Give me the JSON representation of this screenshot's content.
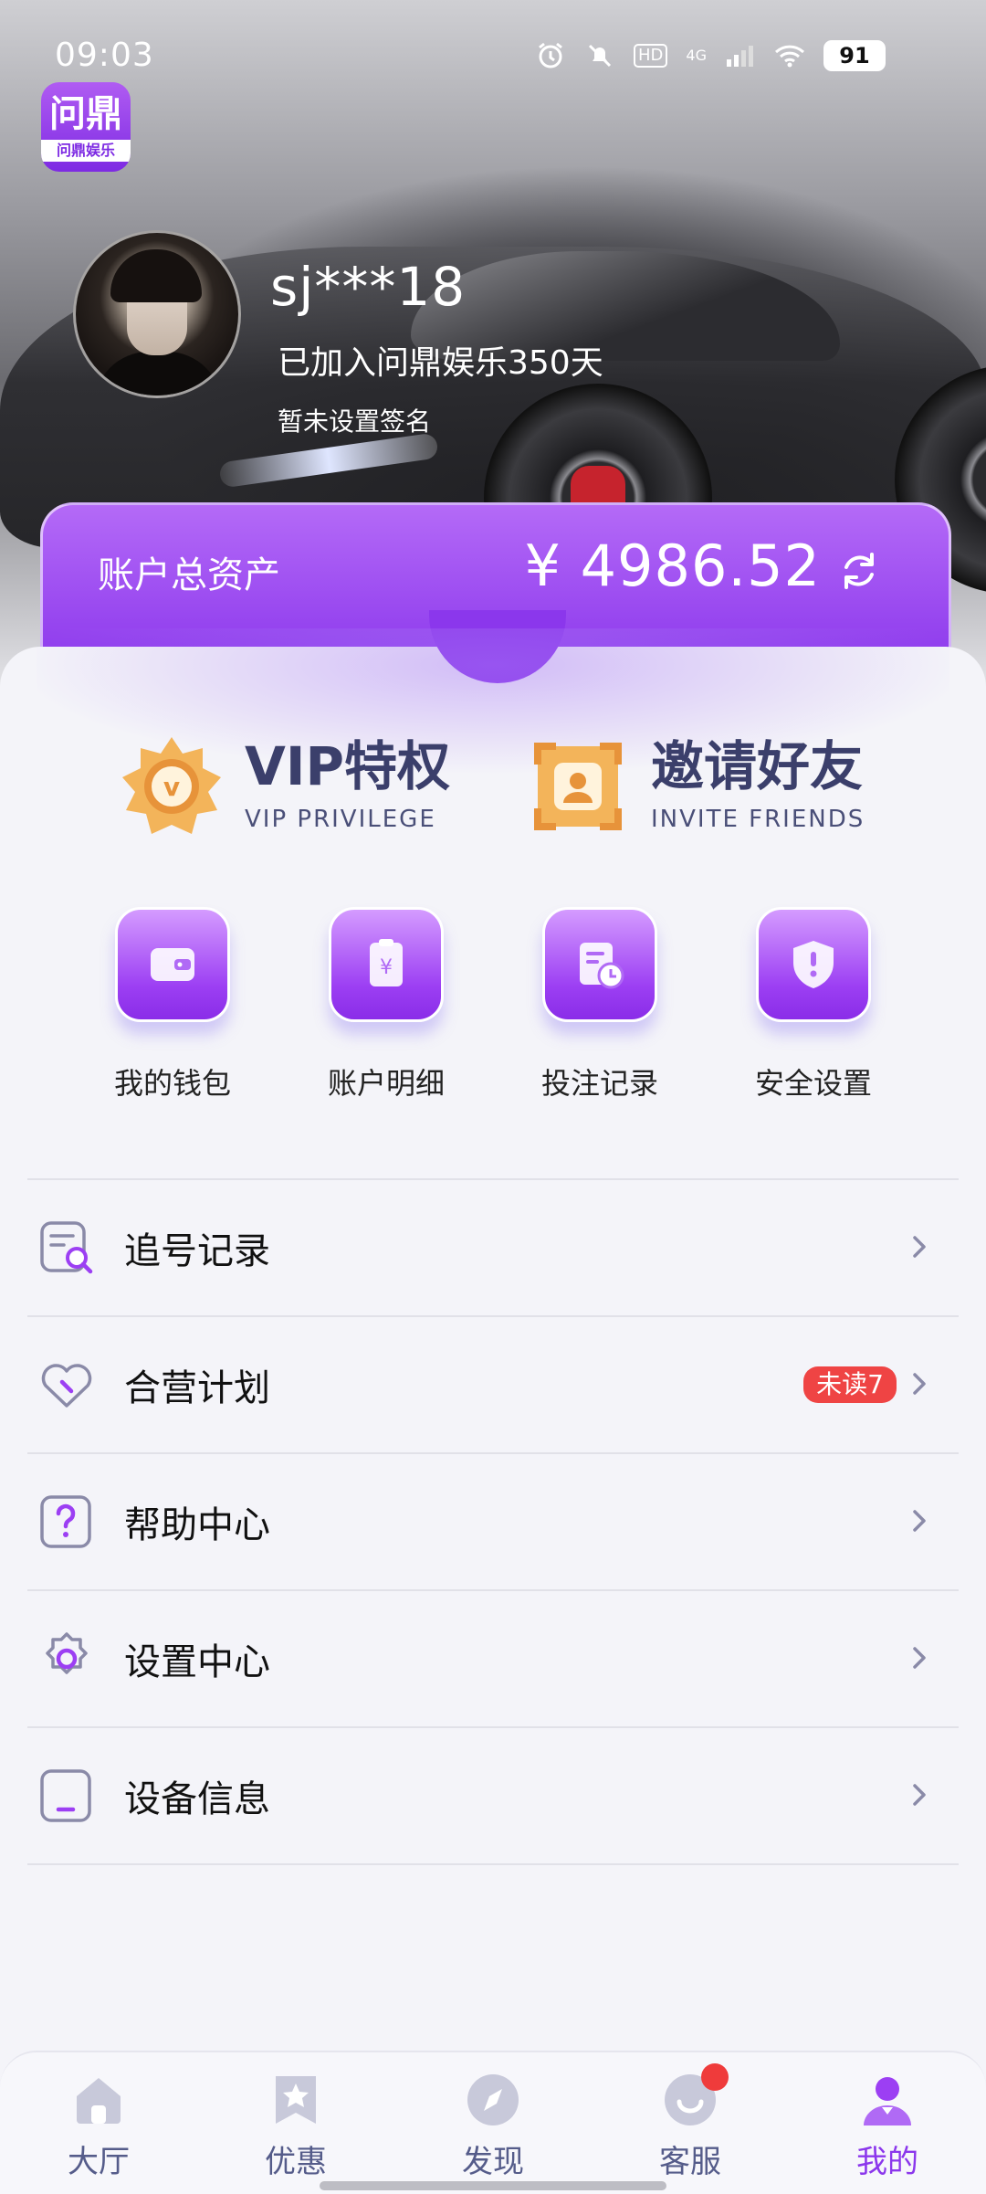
{
  "status_bar": {
    "time": "09:03",
    "hd": "HD",
    "network": "4G",
    "battery": "91"
  },
  "app": {
    "logo_main": "问鼎",
    "logo_sub": "问鼎娱乐"
  },
  "profile": {
    "username": "sj***18",
    "joined": "已加入问鼎娱乐350天",
    "signature": "暂未设置签名"
  },
  "assets": {
    "label": "账户总资产",
    "value": "¥ 4986.52"
  },
  "promos": [
    {
      "title": "VIP特权",
      "subtitle": "VIP PRIVILEGE"
    },
    {
      "title": "邀请好友",
      "subtitle": "INVITE FRIENDS"
    }
  ],
  "quick_actions": [
    {
      "label": "我的钱包",
      "icon": "wallet-icon"
    },
    {
      "label": "账户明细",
      "icon": "statement-icon"
    },
    {
      "label": "投注记录",
      "icon": "bet-record-icon"
    },
    {
      "label": "安全设置",
      "icon": "shield-icon"
    }
  ],
  "menu": [
    {
      "label": "追号记录",
      "icon": "tracking-search-icon"
    },
    {
      "label": "合营计划",
      "icon": "partnership-heart-icon",
      "badge": "未读7"
    },
    {
      "label": "帮助中心",
      "icon": "help-icon"
    },
    {
      "label": "设置中心",
      "icon": "gear-icon"
    },
    {
      "label": "设备信息",
      "icon": "device-icon"
    }
  ],
  "tabs": [
    {
      "label": "大厅",
      "icon": "home-icon"
    },
    {
      "label": "优惠",
      "icon": "bookmark-star-icon"
    },
    {
      "label": "发现",
      "icon": "compass-icon"
    },
    {
      "label": "客服",
      "icon": "customer-service-icon"
    },
    {
      "label": "我的",
      "icon": "profile-icon",
      "active": true
    }
  ],
  "colors": {
    "accent": "#8b37ec",
    "badge_red": "#ef4444",
    "promo_text": "#3b3f6b"
  }
}
